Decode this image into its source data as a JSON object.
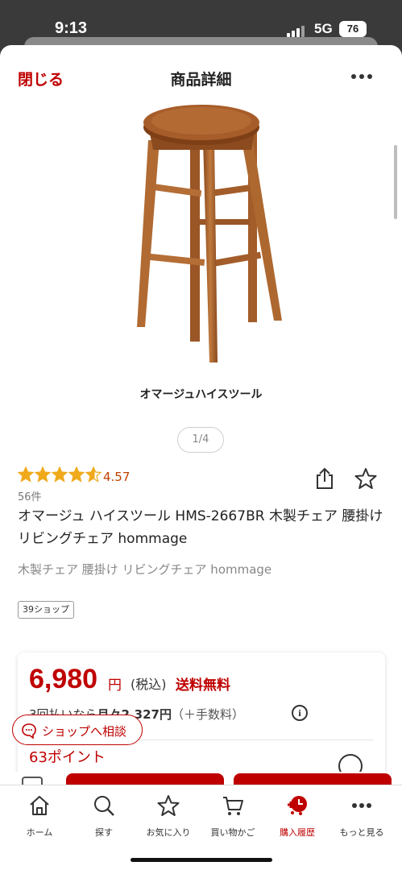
{
  "status_bar": {
    "time": "9:13",
    "network": "5G",
    "battery": "76"
  },
  "header": {
    "close_label": "閉じる",
    "title": "商品詳細",
    "more_icon": "ellipsis-icon"
  },
  "gallery": {
    "caption": "オマージュハイスツール",
    "pager": "1/4"
  },
  "rating": {
    "value": "4.57",
    "stars": 4.57,
    "count": "56件",
    "star_color": "#f0a91b"
  },
  "product": {
    "title": "オマージュ ハイスツール HMS-2667BR 木製チェア 腰掛け リビングチェア hommage",
    "tags": "木製チェア 腰掛け リビングチェア hommage",
    "shop_badge": "39ショップ"
  },
  "pricing": {
    "price": "6,980",
    "unit": "円",
    "tax": "(税込)",
    "shipping": "送料無料",
    "installment_prefix": "3回払いなら",
    "installment_amount": "月々2,327円",
    "installment_fee": "（＋手数料）",
    "points": "63ポイント"
  },
  "consult_button": {
    "label": "ショップへ相談"
  },
  "tabs": [
    {
      "label": "ホーム",
      "icon": "home-icon"
    },
    {
      "label": "探す",
      "icon": "search-icon"
    },
    {
      "label": "お気に入り",
      "icon": "star-icon"
    },
    {
      "label": "買い物かご",
      "icon": "cart-icon"
    },
    {
      "label": "購入履歴",
      "icon": "purchase-history-icon"
    },
    {
      "label": "もっと見る",
      "icon": "ellipsis-icon"
    }
  ],
  "colors": {
    "accent": "#bf0000",
    "rating_text": "#bf4000"
  }
}
